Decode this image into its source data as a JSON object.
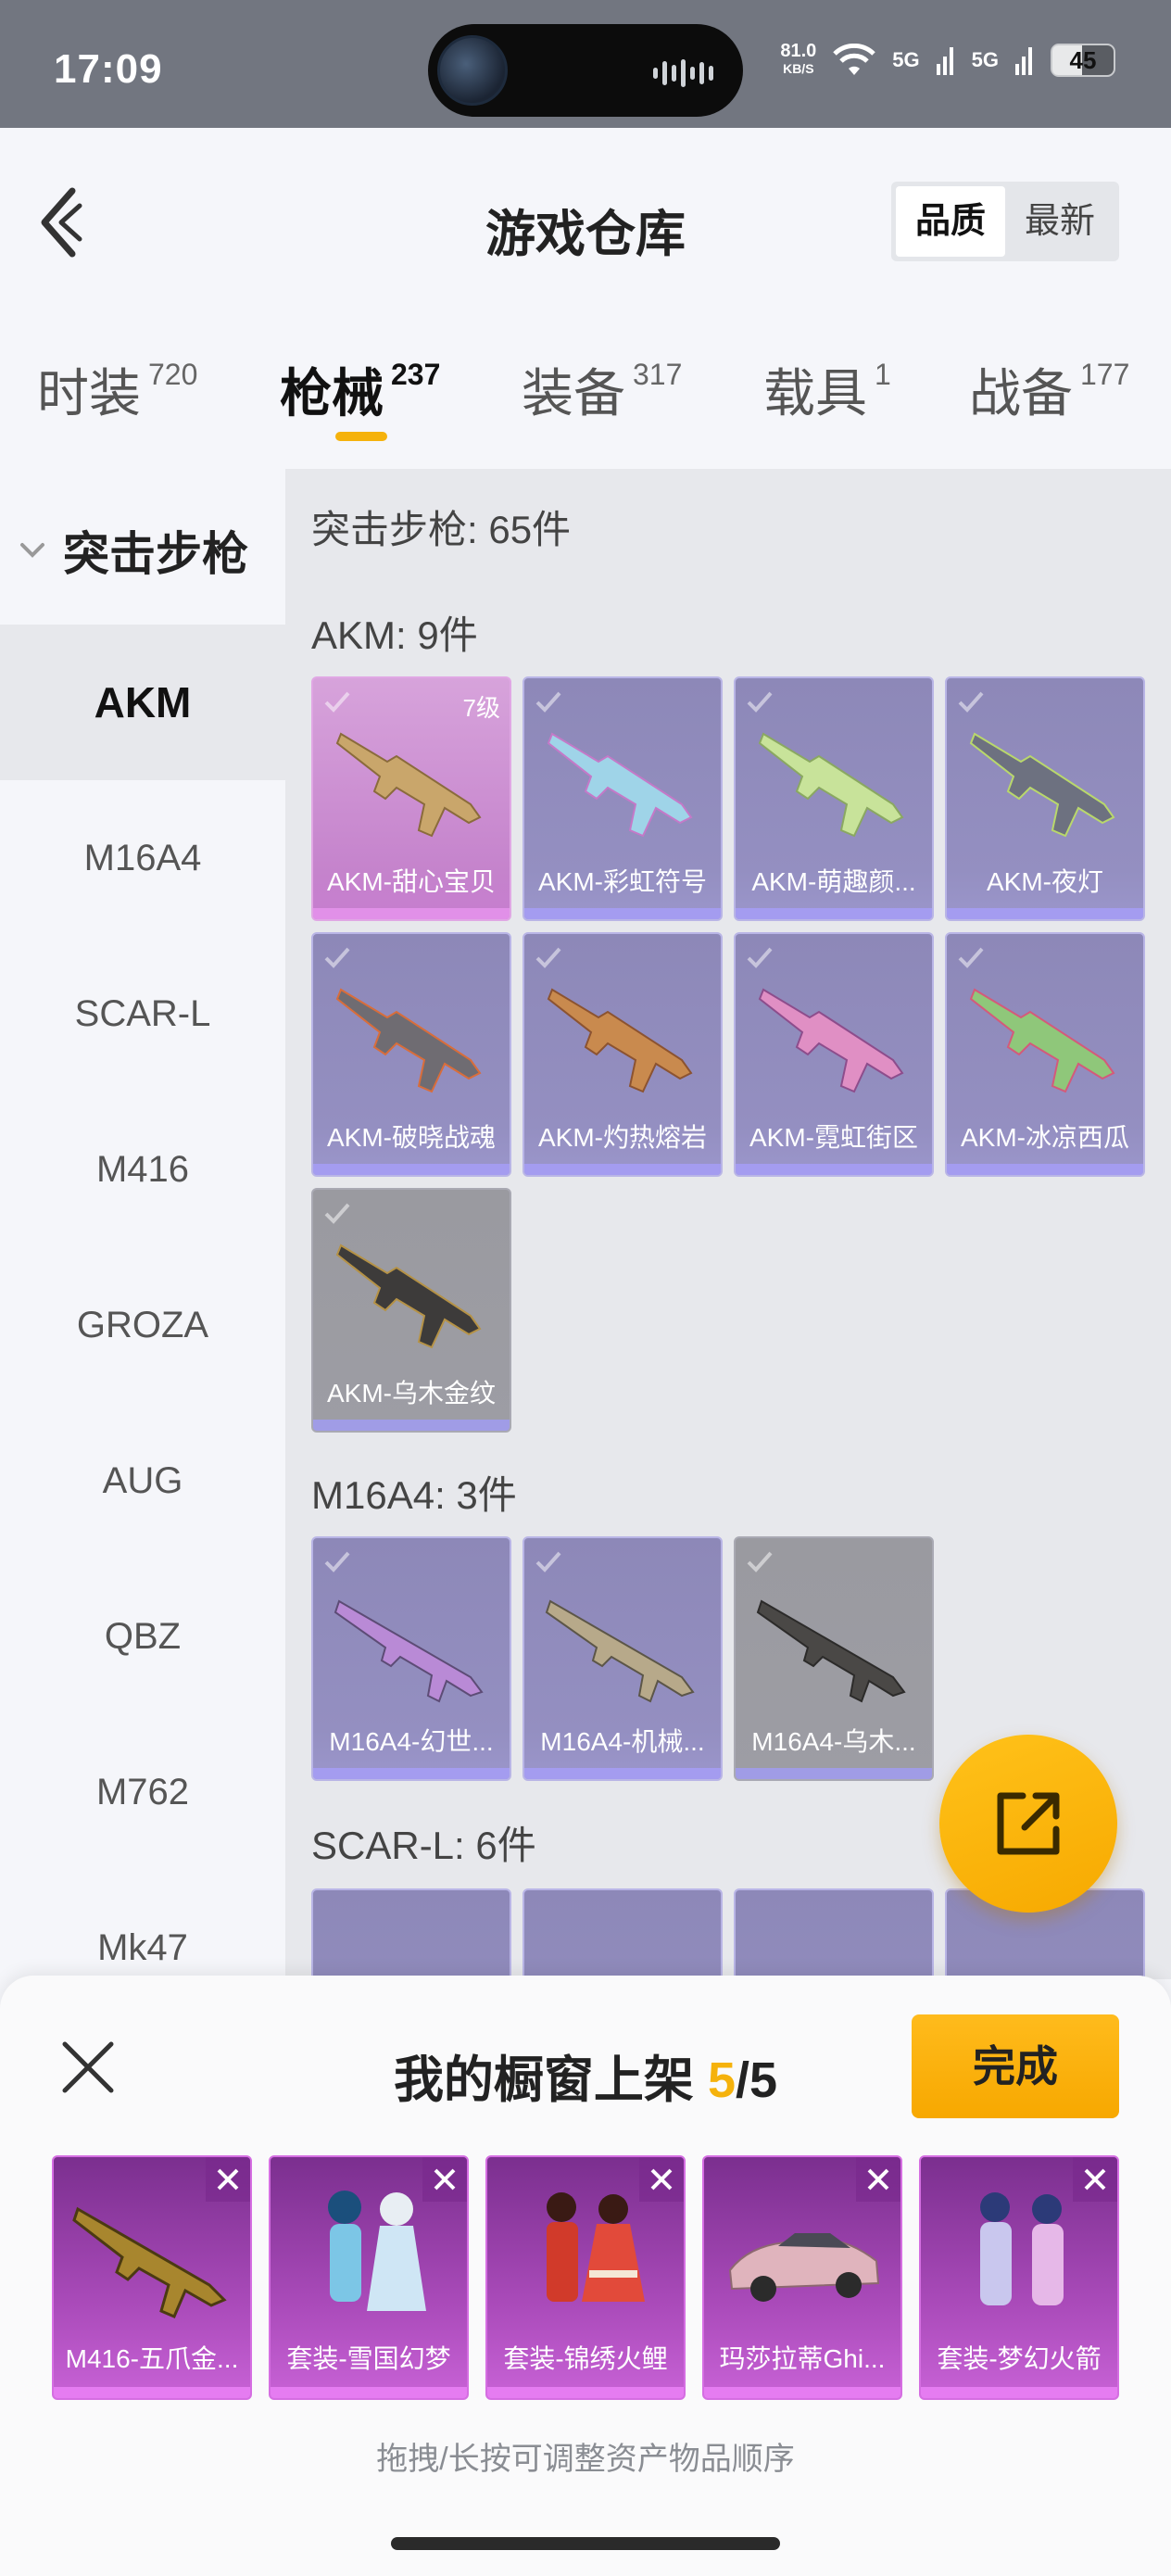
{
  "status_bar": {
    "time": "17:09",
    "net_speed": "81.0",
    "net_unit": "KB/S",
    "signal1": "5G",
    "signal2": "5G",
    "battery": "45"
  },
  "header": {
    "title": "游戏仓库",
    "sort_quality": "品质",
    "sort_latest": "最新"
  },
  "tabs": [
    {
      "label": "时装",
      "count": "720"
    },
    {
      "label": "枪械",
      "count": "237"
    },
    {
      "label": "装备",
      "count": "317"
    },
    {
      "label": "载具",
      "count": "1"
    },
    {
      "label": "战备",
      "count": "177"
    }
  ],
  "sidebar": {
    "category": "突击步枪",
    "items": [
      "AKM",
      "M16A4",
      "SCAR-L",
      "M416",
      "GROZA",
      "AUG",
      "QBZ",
      "M762",
      "Mk47"
    ]
  },
  "content": {
    "summary": "突击步枪: 65件",
    "akm_title": "AKM: 9件",
    "akm_items": [
      {
        "name": "AKM-甜心宝贝",
        "level": "7级"
      },
      {
        "name": "AKM-彩虹符号"
      },
      {
        "name": "AKM-萌趣颜..."
      },
      {
        "name": "AKM-夜灯"
      },
      {
        "name": "AKM-破晓战魂"
      },
      {
        "name": "AKM-灼热熔岩"
      },
      {
        "name": "AKM-霓虹街区"
      },
      {
        "name": "AKM-冰凉西瓜"
      },
      {
        "name": "AKM-乌木金纹"
      }
    ],
    "m16_title": "M16A4: 3件",
    "m16_items": [
      {
        "name": "M16A4-幻世..."
      },
      {
        "name": "M16A4-机械..."
      },
      {
        "name": "M16A4-乌木..."
      }
    ],
    "scar_title": "SCAR-L: 6件"
  },
  "showcase": {
    "title_prefix": "我的橱窗上架 ",
    "current": "5",
    "total": "/5",
    "done_label": "完成",
    "items": [
      {
        "name": "M416-五爪金..."
      },
      {
        "name": "套装-雪国幻梦"
      },
      {
        "name": "套装-锦绣火鲤"
      },
      {
        "name": "玛莎拉蒂Ghi..."
      },
      {
        "name": "套装-梦幻火箭"
      }
    ],
    "hint": "拖拽/长按可调整资产物品顺序"
  },
  "colors": {
    "accent": "#f5b20c",
    "tab_indicator": "#f5b20c",
    "card_purple": "#948fc1",
    "card_pink": "#c583cc",
    "showcase_card": "#a94ab9"
  },
  "icons": [
    "back-arrow-icon",
    "chevron-down-icon",
    "check-icon",
    "share-icon",
    "close-icon",
    "wifi-icon",
    "battery-icon"
  ]
}
